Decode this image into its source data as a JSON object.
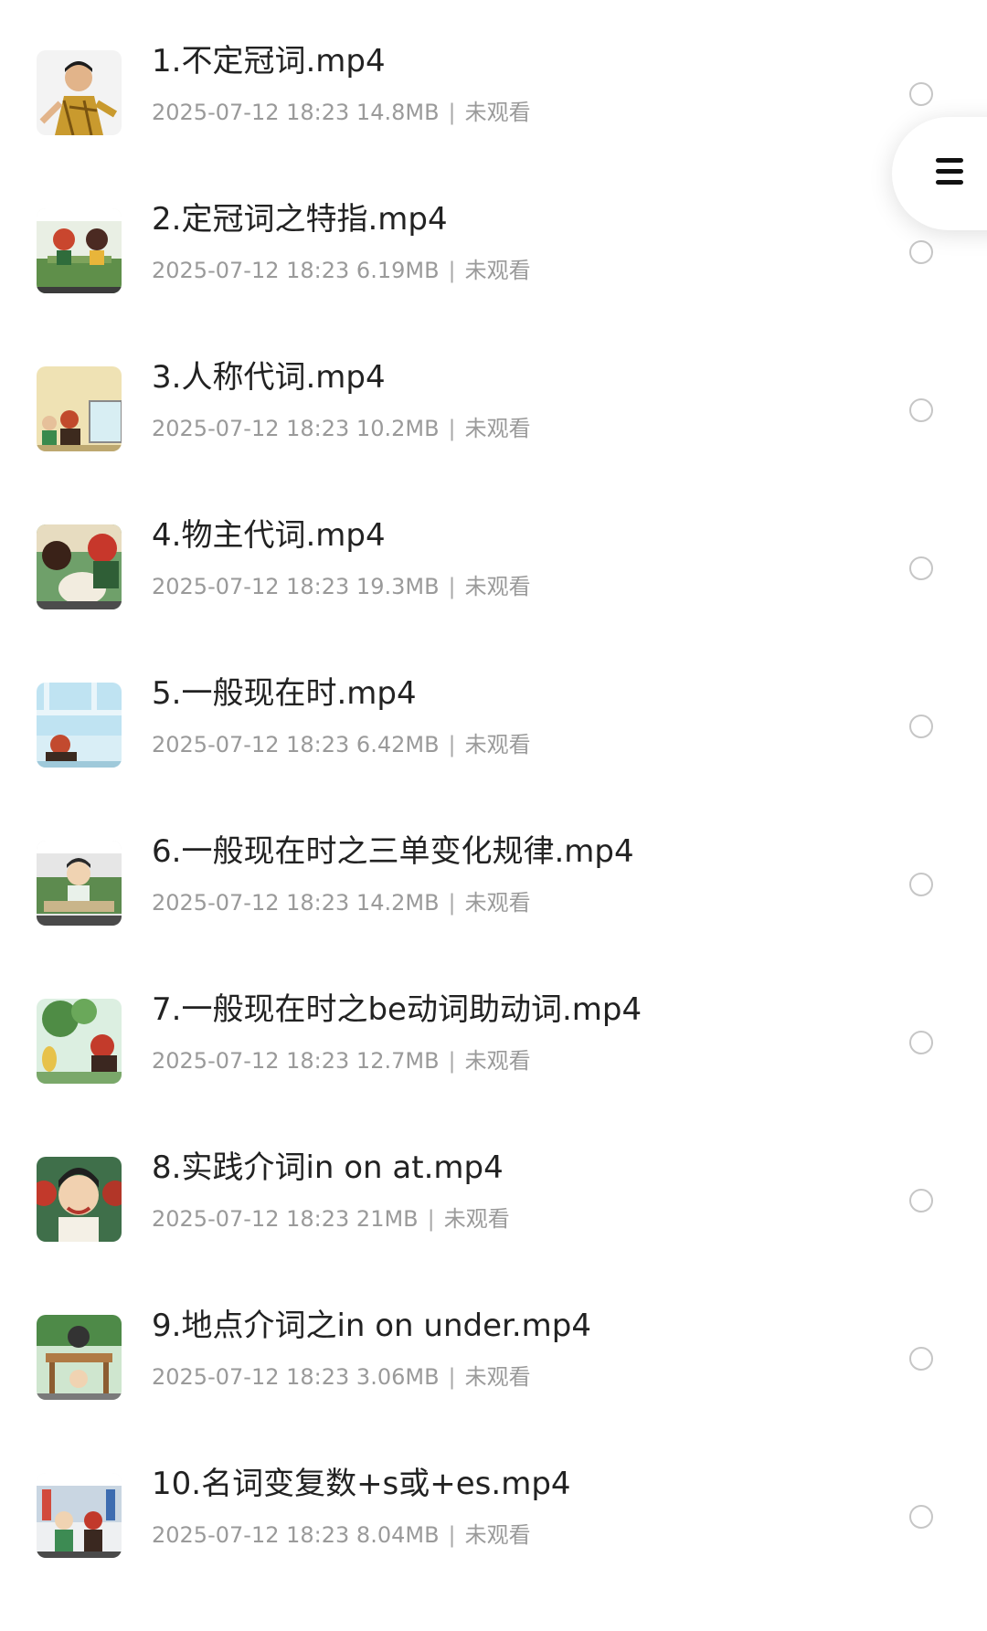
{
  "files": [
    {
      "title": "1.不定冠词.mp4",
      "date": "2025-07-12 18:23",
      "size": "14.8MB",
      "status": "未观看"
    },
    {
      "title": "2.定冠词之特指.mp4",
      "date": "2025-07-12 18:23",
      "size": "6.19MB",
      "status": "未观看"
    },
    {
      "title": "3.人称代词.mp4",
      "date": "2025-07-12 18:23",
      "size": "10.2MB",
      "status": "未观看"
    },
    {
      "title": "4.物主代词.mp4",
      "date": "2025-07-12 18:23",
      "size": "19.3MB",
      "status": "未观看"
    },
    {
      "title": "5.一般现在时.mp4",
      "date": "2025-07-12 18:23",
      "size": "6.42MB",
      "status": "未观看"
    },
    {
      "title": "6.一般现在时之三单变化规律.mp4",
      "date": "2025-07-12 18:23",
      "size": "14.2MB",
      "status": "未观看"
    },
    {
      "title": "7.一般现在时之be动词助动词.mp4",
      "date": "2025-07-12 18:23",
      "size": "12.7MB",
      "status": "未观看"
    },
    {
      "title": "8.实践介词in on at.mp4",
      "date": "2025-07-12 18:23",
      "size": "21MB",
      "status": "未观看"
    },
    {
      "title": "9.地点介词之in on under.mp4",
      "date": "2025-07-12 18:23",
      "size": "3.06MB",
      "status": "未观看"
    },
    {
      "title": "10.名词变复数+s或+es.mp4",
      "date": "2025-07-12 18:23",
      "size": "8.04MB",
      "status": "未观看"
    }
  ],
  "separator": "|",
  "icons": {
    "menu": "hamburger-menu-icon",
    "select": "radio-circle-icon"
  },
  "colors": {
    "title": "#222222",
    "meta": "#9a9a9a",
    "radio_border": "#c6c6c6",
    "background": "#ffffff"
  }
}
